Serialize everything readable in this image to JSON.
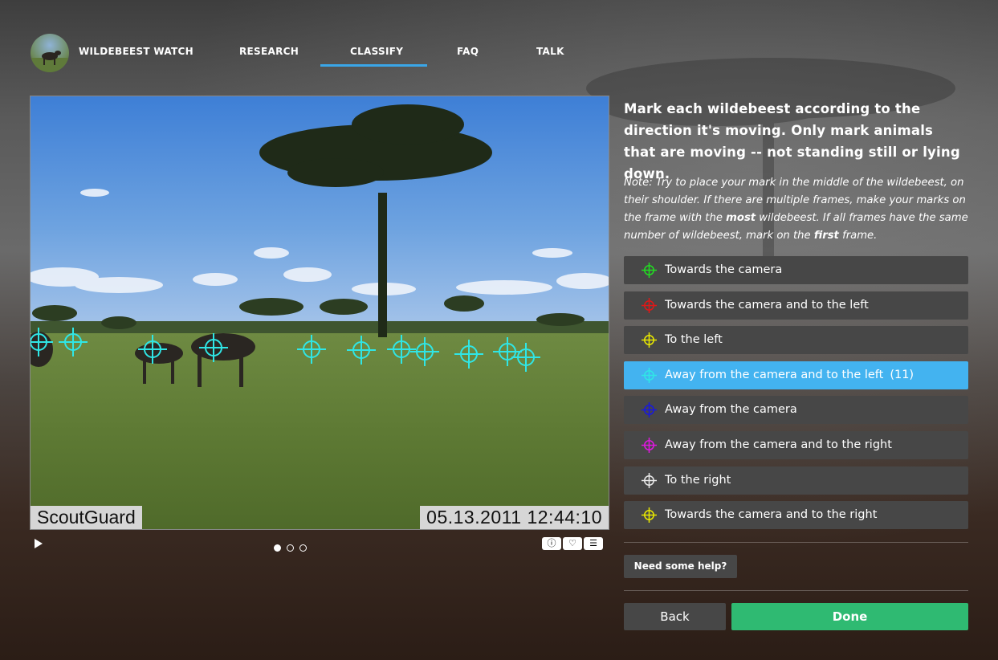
{
  "nav": {
    "brand": "WILDEBEEST WATCH",
    "items": [
      {
        "label": "RESEARCH"
      },
      {
        "label": "CLASSIFY",
        "active": true
      },
      {
        "label": "FAQ"
      },
      {
        "label": "TALK"
      }
    ]
  },
  "photo": {
    "camera_brand": "ScoutGuard",
    "timestamp": "05.13.2011 12:44:10",
    "frames": 3,
    "current_frame": 1
  },
  "task": {
    "instruction": "Mark each wildebeest according to the direction it's moving. Only mark animals that are moving -- not standing still or lying down.",
    "note_parts": [
      "Note: Try to place your mark in the middle of the wildebeest, on their shoulder. If there are multiple frames, make your marks on the frame with the ",
      "most",
      " wildebeest. If all frames have the same number of wildebeest, mark on the ",
      "first",
      " frame."
    ],
    "options": [
      {
        "label": "Towards the camera",
        "color": "#22dd22",
        "count": ""
      },
      {
        "label": "Towards the camera and to the left",
        "color": "#e01818",
        "count": ""
      },
      {
        "label": "To the left",
        "color": "#e8e800",
        "count": ""
      },
      {
        "label": "Away from the camera and to the left",
        "color": "#2fe6e6",
        "count": "(11)",
        "selected": true
      },
      {
        "label": "Away from the camera",
        "color": "#1818e0",
        "count": ""
      },
      {
        "label": "Away from the camera and to the right",
        "color": "#e018e0",
        "count": ""
      },
      {
        "label": "To the right",
        "color": "#e8e8e8",
        "count": ""
      },
      {
        "label": "Towards the camera and to the right",
        "color": "#e8e800",
        "count": ""
      }
    ],
    "help_label": "Need some help?",
    "back_label": "Back",
    "done_label": "Done"
  },
  "colors": {
    "accent": "#3aa6e8",
    "selected": "#43b3f0",
    "done": "#2fba72",
    "button": "#474747",
    "marker": "#2fe6e6"
  },
  "icons": {
    "play": "play-icon",
    "info": "info-icon",
    "favorite": "heart-icon",
    "metadata": "list-icon"
  }
}
